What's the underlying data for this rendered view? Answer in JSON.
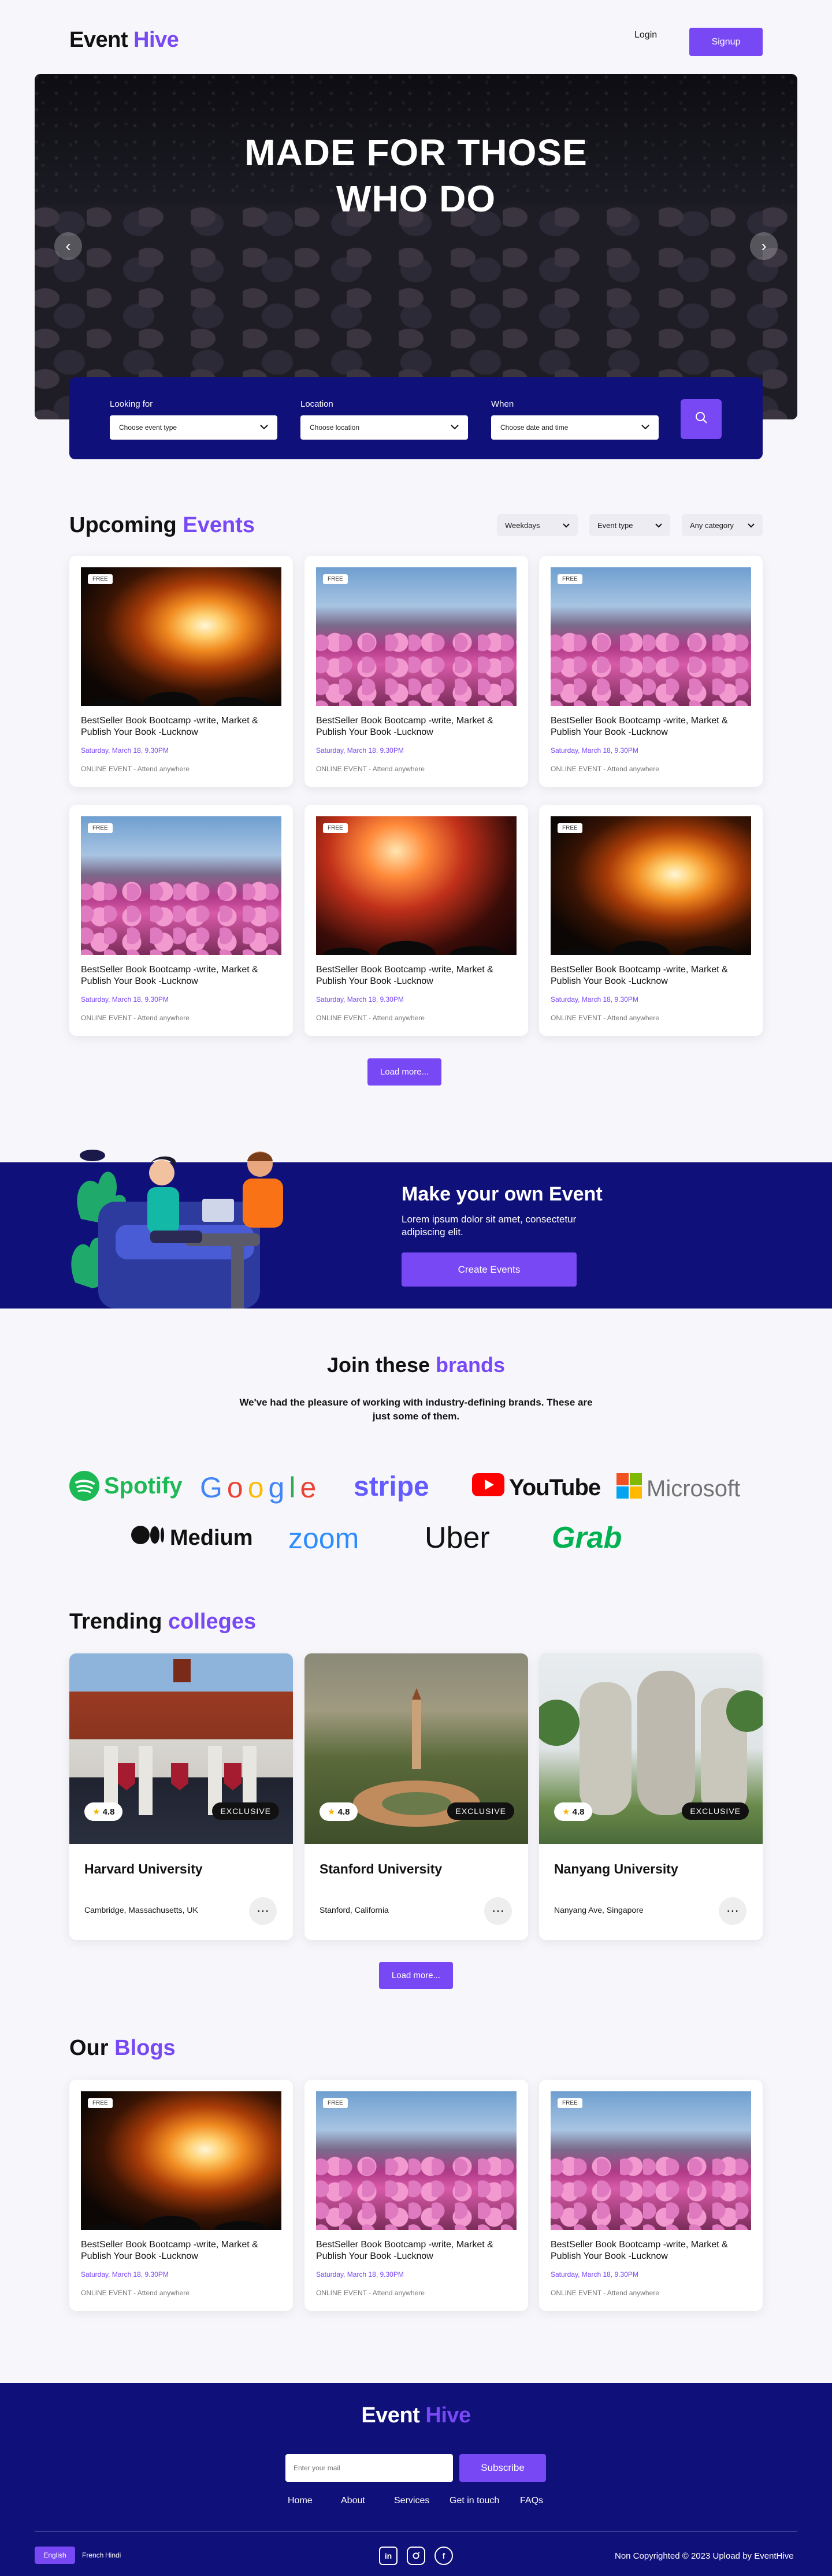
{
  "header": {
    "logo_part1": "Event",
    "logo_part2": "Hive",
    "login": "Login",
    "signup": "Signup"
  },
  "hero": {
    "title_line1": "MADE FOR THOSE",
    "title_line2": "WHO DO"
  },
  "search": {
    "looking_for": {
      "label": "Looking for",
      "value": "Choose event type"
    },
    "location": {
      "label": "Location",
      "value": "Choose location"
    },
    "when": {
      "label": "When",
      "value": "Choose date and time"
    }
  },
  "upcoming": {
    "title_part1": "Upcoming",
    "title_part2": "Events",
    "filters": [
      "Weekdays",
      "Event type",
      "Any category"
    ],
    "load_more": "Load more..."
  },
  "events": [
    {
      "badge": "FREE",
      "title": "BestSeller Book Bootcamp -write, Market & Publish Your Book -Lucknow",
      "date": "Saturday, March 18, 9.30PM",
      "location": "ONLINE EVENT - Attend anywhere",
      "image": "fire"
    },
    {
      "badge": "FREE",
      "title": "BestSeller Book Bootcamp -write, Market & Publish Your Book -Lucknow",
      "date": "Saturday, March 18, 9.30PM",
      "location": "ONLINE EVENT - Attend anywhere",
      "image": "crowd"
    },
    {
      "badge": "FREE",
      "title": "BestSeller Book Bootcamp -write, Market & Publish Your Book -Lucknow",
      "date": "Saturday, March 18, 9.30PM",
      "location": "ONLINE EVENT - Attend anywhere",
      "image": "crowd"
    },
    {
      "badge": "FREE",
      "title": "BestSeller Book Bootcamp -write, Market & Publish Your Book -Lucknow",
      "date": "Saturday, March 18, 9.30PM",
      "location": "ONLINE EVENT - Attend anywhere",
      "image": "crowd"
    },
    {
      "badge": "FREE",
      "title": "BestSeller Book Bootcamp -write, Market & Publish Your Book -Lucknow",
      "date": "Saturday, March 18, 9.30PM",
      "location": "ONLINE EVENT - Attend anywhere",
      "image": "concert"
    },
    {
      "badge": "FREE",
      "title": "BestSeller Book Bootcamp -write, Market & Publish Your Book -Lucknow",
      "date": "Saturday, March 18, 9.30PM",
      "location": "ONLINE EVENT - Attend anywhere",
      "image": "fire"
    }
  ],
  "banner": {
    "title": "Make your own Event",
    "text": "Lorem ipsum dolor sit amet, consectetur adipiscing elit.",
    "button": "Create Events"
  },
  "brands": {
    "title_part1": "Join these",
    "title_part2": "brands",
    "subtitle": "We've had the pleasure of working with industry-defining brands. These are just some of them.",
    "row1": [
      "Spotify",
      "Google",
      "stripe",
      "YouTube",
      "Microsoft"
    ],
    "row2": [
      "Medium",
      "zoom",
      "Uber",
      "Grab"
    ],
    "colors": {
      "spotify": "#1db954",
      "google_blue": "#4285f4",
      "google_red": "#ea4335",
      "google_yellow": "#fbbc05",
      "google_green": "#34a853",
      "stripe": "#635bff",
      "youtube": "#ff0000",
      "zoom": "#2d8cff",
      "grab": "#00b14f"
    }
  },
  "colleges": {
    "title_part1": "Trending",
    "title_part2": "colleges",
    "items": [
      {
        "name": "Harvard University",
        "location": "Cambridge, Massachusetts, UK",
        "rating": "4.8",
        "tag": "EXCLUSIVE"
      },
      {
        "name": "Stanford University",
        "location": "Stanford, California",
        "rating": "4.8",
        "tag": "EXCLUSIVE"
      },
      {
        "name": "Nanyang University",
        "location": "Nanyang Ave, Singapore",
        "rating": "4.8",
        "tag": "EXCLUSIVE"
      }
    ],
    "load_more": "Load more..."
  },
  "blogs": {
    "title_part1": "Our",
    "title_part2": "Blogs",
    "items": [
      {
        "badge": "FREE",
        "title": "BestSeller Book Bootcamp -write, Market & Publish Your Book -Lucknow",
        "date": "Saturday, March 18, 9.30PM",
        "location": "ONLINE EVENT - Attend anywhere",
        "image": "fire"
      },
      {
        "badge": "FREE",
        "title": "BestSeller Book Bootcamp -write, Market & Publish Your Book -Lucknow",
        "date": "Saturday, March 18, 9.30PM",
        "location": "ONLINE EVENT - Attend anywhere",
        "image": "crowd"
      },
      {
        "badge": "FREE",
        "title": "BestSeller Book Bootcamp -write, Market & Publish Your Book -Lucknow",
        "date": "Saturday, March 18, 9.30PM",
        "location": "ONLINE EVENT - Attend anywhere",
        "image": "crowd"
      }
    ]
  },
  "footer": {
    "logo_part1": "Event",
    "logo_part2": "Hive",
    "email_placeholder": "Enter your mail",
    "subscribe": "Subscribe",
    "nav": [
      "Home",
      "About",
      "Services",
      "Get in touch",
      "FAQs"
    ],
    "languages": [
      "English",
      "French",
      "Hindi"
    ],
    "socials": [
      "linkedin-icon",
      "instagram-icon",
      "facebook-icon"
    ],
    "copyright": "Non Copyrighted © 2023 Upload by EventHive"
  },
  "colors": {
    "accent": "#7848f4",
    "navy": "#10107a"
  }
}
